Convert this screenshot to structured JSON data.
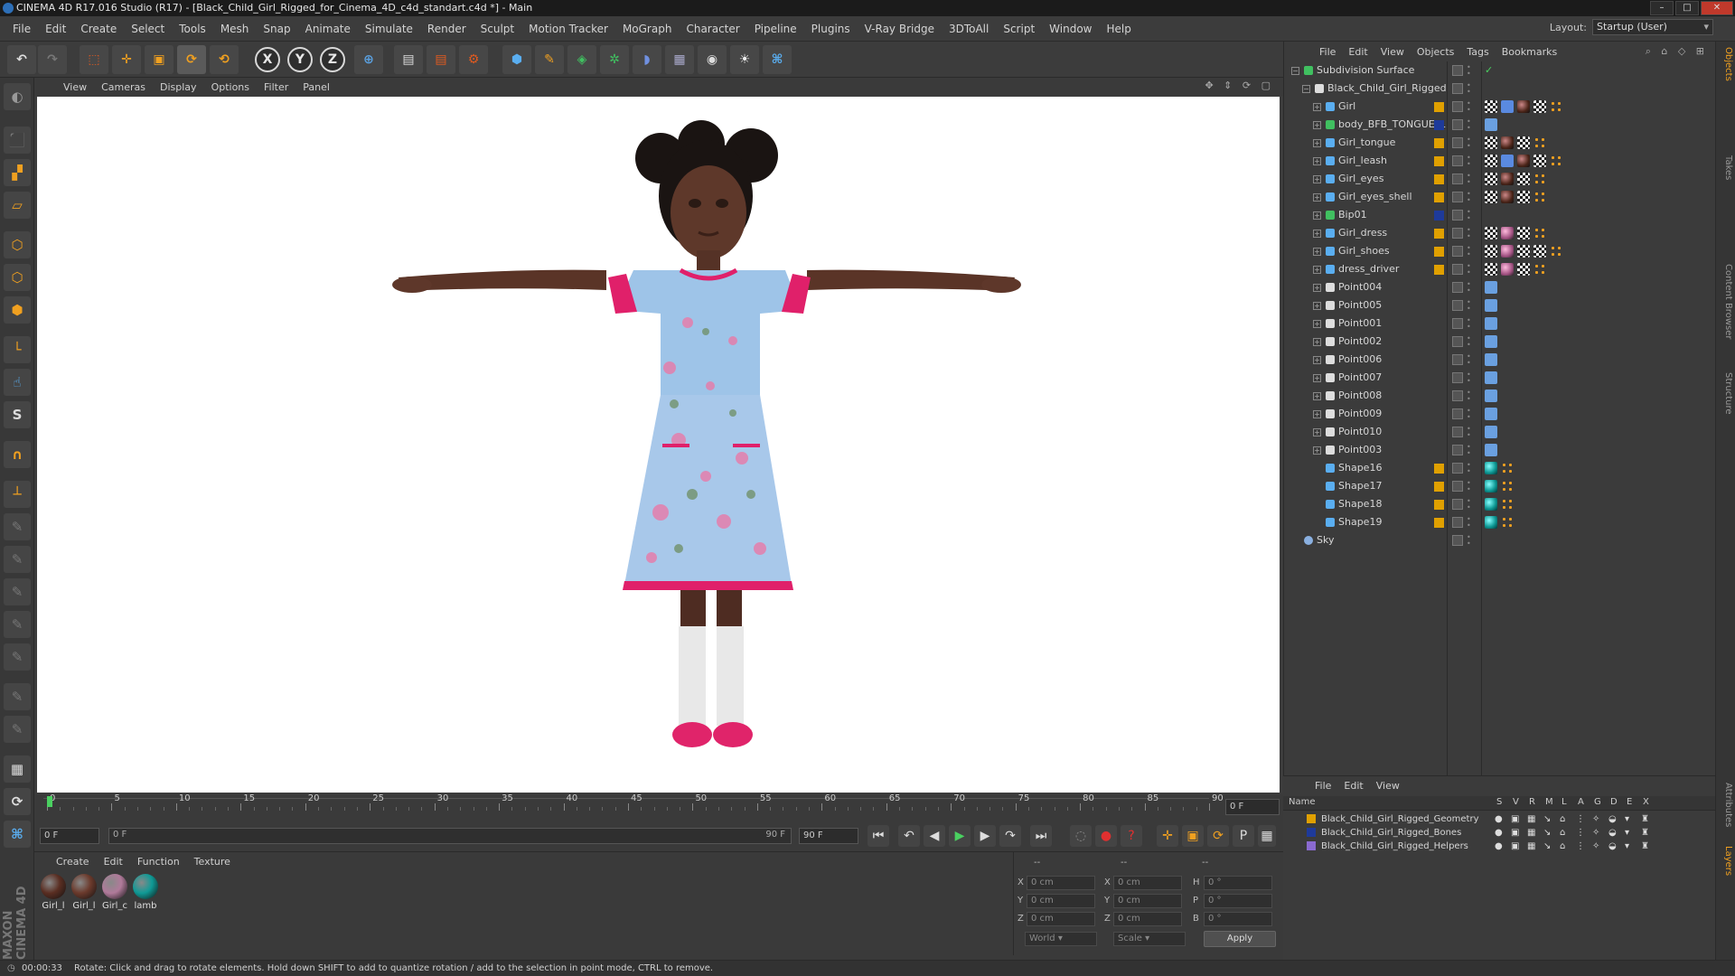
{
  "window": {
    "title": "CINEMA 4D R17.016 Studio (R17) - [Black_Child_Girl_Rigged_for_Cinema_4D_c4d_standart.c4d *] - Main"
  },
  "menubar": {
    "items": [
      "File",
      "Edit",
      "Create",
      "Select",
      "Tools",
      "Mesh",
      "Snap",
      "Animate",
      "Simulate",
      "Render",
      "Sculpt",
      "Motion Tracker",
      "MoGraph",
      "Character",
      "Pipeline",
      "Plugins",
      "V-Ray Bridge",
      "3DToAll",
      "Script",
      "Window",
      "Help"
    ],
    "layout_label": "Layout:",
    "layout_value": "Startup (User)"
  },
  "toolbar": {
    "axis_x": "X",
    "axis_y": "Y",
    "axis_z": "Z"
  },
  "viewport": {
    "menu": [
      "View",
      "Cameras",
      "Display",
      "Options",
      "Filter",
      "Panel"
    ]
  },
  "timeline": {
    "ticks": [
      "0",
      "5",
      "10",
      "15",
      "20",
      "25",
      "30",
      "35",
      "40",
      "45",
      "50",
      "55",
      "60",
      "65",
      "70",
      "75",
      "80",
      "85",
      "90"
    ],
    "end_field": "0 F"
  },
  "transport": {
    "start_frame": "0 F",
    "range_start": "0 F",
    "range_end": "90 F",
    "end_frame": "90 F"
  },
  "materials": {
    "menu": [
      "Create",
      "Edit",
      "Function",
      "Texture"
    ],
    "items": [
      {
        "label": "Girl_l",
        "color": "#5a2e22"
      },
      {
        "label": "Girl_l",
        "color": "#6b3a2c"
      },
      {
        "label": "Girl_c",
        "color": "#b07a9a"
      },
      {
        "label": "lamb",
        "color": "#0f9a96"
      }
    ]
  },
  "coords": {
    "headers": [
      "--",
      "--",
      "--"
    ],
    "rows": [
      {
        "a": "X",
        "av": "0 cm",
        "b": "X",
        "bv": "0 cm",
        "c": "H",
        "cv": "0 °"
      },
      {
        "a": "Y",
        "av": "0 cm",
        "b": "Y",
        "bv": "0 cm",
        "c": "P",
        "cv": "0 °"
      },
      {
        "a": "Z",
        "av": "0 cm",
        "b": "Z",
        "bv": "0 cm",
        "c": "B",
        "cv": "0 °"
      }
    ],
    "world": "World",
    "scale": "Scale",
    "apply": "Apply"
  },
  "status": {
    "time": "00:00:33",
    "message": "Rotate: Click and drag to rotate elements. Hold down SHIFT to add to quantize rotation / add to the selection in point mode, CTRL to remove."
  },
  "objects": {
    "menu": [
      "File",
      "Edit",
      "View",
      "Objects",
      "Tags",
      "Bookmarks"
    ],
    "tree": [
      {
        "name": "Subdivision Surface",
        "layer": "",
        "tags": [
          "check"
        ],
        "level": 0,
        "exp": "−"
      },
      {
        "name": "Black_Child_Girl_Rigged",
        "layer": "",
        "tags": [],
        "level": 1,
        "exp": "−"
      },
      {
        "name": "Girl",
        "layer": "#e0a000",
        "tags": [
          "checker",
          "bone",
          "mat",
          "checker",
          "orange"
        ],
        "level": 2,
        "exp": "+"
      },
      {
        "name": "body_BFB_TONGUE_1",
        "layer": "#1e3a9a",
        "tags": [
          "pin"
        ],
        "level": 2,
        "exp": "+"
      },
      {
        "name": "Girl_tongue",
        "layer": "#e0a000",
        "tags": [
          "checker",
          "mat",
          "checker",
          "orange"
        ],
        "level": 2,
        "exp": "+"
      },
      {
        "name": "Girl_leash",
        "layer": "#e0a000",
        "tags": [
          "checker",
          "bone",
          "mat",
          "checker",
          "orange"
        ],
        "level": 2,
        "exp": "+"
      },
      {
        "name": "Girl_eyes",
        "layer": "#e0a000",
        "tags": [
          "checker",
          "mat",
          "checker",
          "orange"
        ],
        "level": 2,
        "exp": "+"
      },
      {
        "name": "Girl_eyes_shell",
        "layer": "#e0a000",
        "tags": [
          "checker",
          "mat",
          "checker",
          "orange"
        ],
        "level": 2,
        "exp": "+"
      },
      {
        "name": "Bip01",
        "layer": "#1e3a9a",
        "tags": [],
        "level": 2,
        "exp": "+"
      },
      {
        "name": "Girl_dress",
        "layer": "#e0a000",
        "tags": [
          "checker",
          "pinkmat",
          "checker",
          "orange"
        ],
        "level": 2,
        "exp": "+"
      },
      {
        "name": "Girl_shoes",
        "layer": "#e0a000",
        "tags": [
          "checker",
          "pinkmat",
          "checker",
          "checker",
          "orange"
        ],
        "level": 2,
        "exp": "+"
      },
      {
        "name": "dress_driver",
        "layer": "#e0a000",
        "tags": [
          "checker",
          "pinkmat",
          "checker",
          "orange"
        ],
        "level": 2,
        "exp": "+"
      },
      {
        "name": "Point004",
        "layer": "",
        "tags": [
          "pin"
        ],
        "level": 2,
        "exp": "+"
      },
      {
        "name": "Point005",
        "layer": "",
        "tags": [
          "pin"
        ],
        "level": 2,
        "exp": "+"
      },
      {
        "name": "Point001",
        "layer": "",
        "tags": [
          "pin"
        ],
        "level": 2,
        "exp": "+"
      },
      {
        "name": "Point002",
        "layer": "",
        "tags": [
          "pin"
        ],
        "level": 2,
        "exp": "+"
      },
      {
        "name": "Point006",
        "layer": "",
        "tags": [
          "pin"
        ],
        "level": 2,
        "exp": "+"
      },
      {
        "name": "Point007",
        "layer": "",
        "tags": [
          "pin"
        ],
        "level": 2,
        "exp": "+"
      },
      {
        "name": "Point008",
        "layer": "",
        "tags": [
          "pin"
        ],
        "level": 2,
        "exp": "+"
      },
      {
        "name": "Point009",
        "layer": "",
        "tags": [
          "pin"
        ],
        "level": 2,
        "exp": "+"
      },
      {
        "name": "Point010",
        "layer": "",
        "tags": [
          "pin"
        ],
        "level": 2,
        "exp": "+"
      },
      {
        "name": "Point003",
        "layer": "",
        "tags": [
          "pin"
        ],
        "level": 2,
        "exp": "+"
      },
      {
        "name": "Shape16",
        "layer": "#e0a000",
        "tags": [
          "teal",
          "orange"
        ],
        "level": 2,
        "exp": ""
      },
      {
        "name": "Shape17",
        "layer": "#e0a000",
        "tags": [
          "teal",
          "orange"
        ],
        "level": 2,
        "exp": ""
      },
      {
        "name": "Shape18",
        "layer": "#e0a000",
        "tags": [
          "teal",
          "orange"
        ],
        "level": 2,
        "exp": ""
      },
      {
        "name": "Shape19",
        "layer": "#e0a000",
        "tags": [
          "teal",
          "orange"
        ],
        "level": 2,
        "exp": ""
      },
      {
        "name": "Sky",
        "layer": "",
        "tags": [],
        "level": 0,
        "exp": ""
      }
    ]
  },
  "side_tabs": [
    "Objects",
    "Takes",
    "Content Browser",
    "Structure"
  ],
  "side_tabs_bottom": [
    "Attributes",
    "Layers"
  ],
  "layers": {
    "menu": [
      "File",
      "Edit",
      "View"
    ],
    "name_header": "Name",
    "flag_headers": [
      "S",
      "V",
      "R",
      "M",
      "L",
      "A",
      "G",
      "D",
      "E",
      "X"
    ],
    "rows": [
      {
        "name": "Black_Child_Girl_Rigged_Geometry",
        "color": "#e0a000"
      },
      {
        "name": "Black_Child_Girl_Rigged_Bones",
        "color": "#1e3a9a"
      },
      {
        "name": "Black_Child_Girl_Rigged_Helpers",
        "color": "#8a6ad0"
      }
    ]
  }
}
